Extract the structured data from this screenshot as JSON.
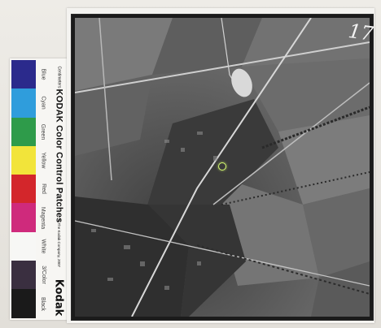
{
  "photo": {
    "frame_number": "17"
  },
  "kodak_strip": {
    "title": "KODAK Color Control Patches",
    "brand": "Kodak",
    "centimeters": "Centimeters",
    "small_print": "© The Kodak Company, 2007",
    "patches": [
      {
        "label": "Blue",
        "color": "#2b2a8c"
      },
      {
        "label": "Cyan",
        "color": "#2f9ddc"
      },
      {
        "label": "Green",
        "color": "#2e9b4a"
      },
      {
        "label": "Yellow",
        "color": "#f2e43a"
      },
      {
        "label": "Red",
        "color": "#d3262b"
      },
      {
        "label": "Magenta",
        "color": "#cf2a7c"
      },
      {
        "label": "White",
        "color": "#f7f7f5"
      },
      {
        "label": "3/Color",
        "color": "#3a2f40"
      },
      {
        "label": "Black",
        "color": "#1a1a1a"
      }
    ]
  }
}
